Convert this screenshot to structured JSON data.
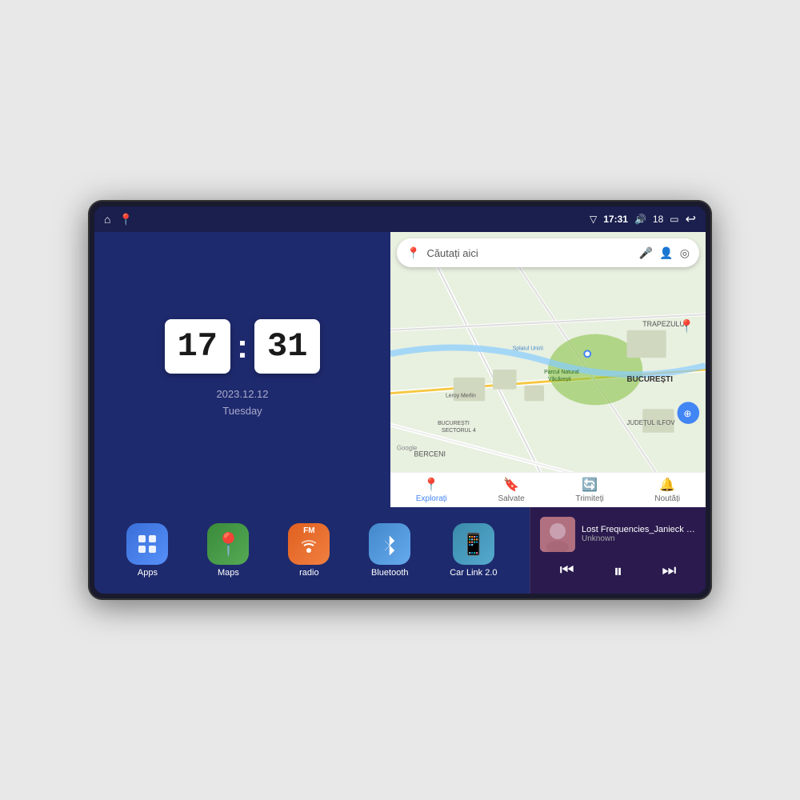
{
  "device": {
    "status_bar": {
      "left_icons": [
        "home-icon",
        "maps-icon"
      ],
      "signal_icon": "▽",
      "time": "17:31",
      "volume_icon": "🔊",
      "battery_level": "18",
      "battery_icon": "🔋",
      "back_icon": "↩"
    },
    "clock": {
      "hour": "17",
      "minute": "31",
      "date": "2023.12.12",
      "day": "Tuesday"
    },
    "map": {
      "search_placeholder": "Căutați aici",
      "nav_items": [
        {
          "label": "Explorați",
          "icon": "📍",
          "active": true
        },
        {
          "label": "Salvate",
          "icon": "🔖",
          "active": false
        },
        {
          "label": "Trimiteți",
          "icon": "🔄",
          "active": false
        },
        {
          "label": "Noutăți",
          "icon": "🔔",
          "active": false
        }
      ],
      "map_labels": [
        "TRAPEZULUI",
        "BUCUREȘTI",
        "JUDEȚUL ILFOV",
        "BERCENI",
        "Parcul Natural Văcărești",
        "Leroy Merlin",
        "BUCUREȘTI SECTORUL 4",
        "Splaiul Unirii"
      ]
    },
    "apps": [
      {
        "id": "apps",
        "label": "Apps",
        "icon": "⊞",
        "color": "#3a6fd8"
      },
      {
        "id": "maps",
        "label": "Maps",
        "icon": "📍",
        "color": "#3a8a3a"
      },
      {
        "id": "radio",
        "label": "radio",
        "icon": "📻",
        "color": "#e06020"
      },
      {
        "id": "bluetooth",
        "label": "Bluetooth",
        "icon": "🔵",
        "color": "#4488cc"
      },
      {
        "id": "carlink",
        "label": "Car Link 2.0",
        "icon": "📱",
        "color": "#3a8aaa"
      }
    ],
    "music": {
      "title": "Lost Frequencies_Janieck Devy-...",
      "artist": "Unknown",
      "prev_label": "⏮",
      "play_label": "⏸",
      "next_label": "⏭"
    }
  }
}
